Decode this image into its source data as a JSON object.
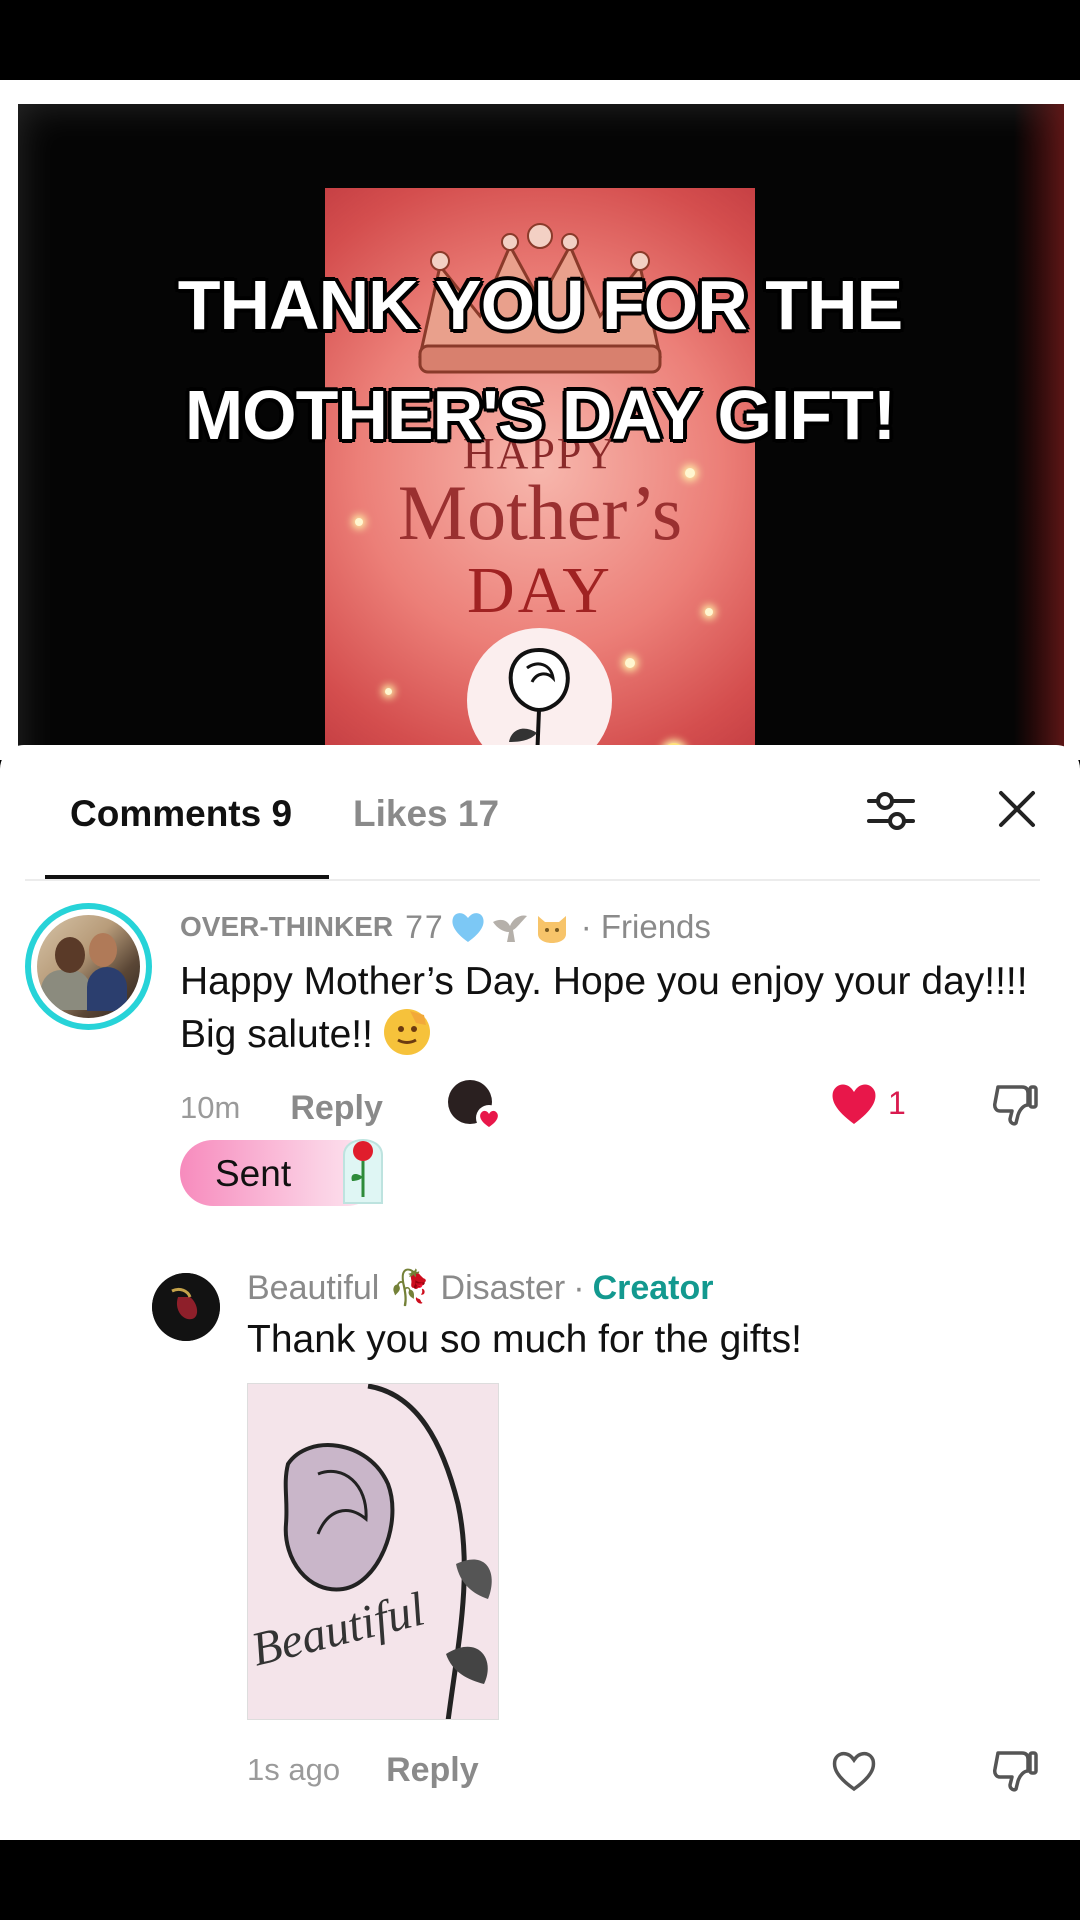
{
  "video": {
    "caption_line1": "THANK YOU FOR THE",
    "caption_line2": "MOTHER'S DAY GIFT!",
    "poster_happy": "HAPPY",
    "poster_mothers": "Mother’s",
    "poster_day": "DAY"
  },
  "tabs": {
    "comments": "Comments 9",
    "likes": "Likes 17"
  },
  "comment": {
    "username": "OVER-THINKER",
    "username_suffix": "77",
    "relation": "· Friends",
    "text": "Happy Mother’s Day. Hope you enjoy your day!!!! Big salute!!",
    "time": "10m",
    "reply_label": "Reply",
    "like_count": "1",
    "gift_label": "Sent"
  },
  "reply": {
    "username": "Beautiful 🥀 Disaster",
    "separator": "·",
    "role": "Creator",
    "text": "Thank you so much for the gifts!",
    "image_word": "Beautiful",
    "time": "1s ago",
    "reply_label": "Reply"
  },
  "colors": {
    "creator": "#13998f",
    "like": "#e8174a",
    "avatar_ring": "#27d3d8",
    "gift_pill": "#f78bbd"
  }
}
